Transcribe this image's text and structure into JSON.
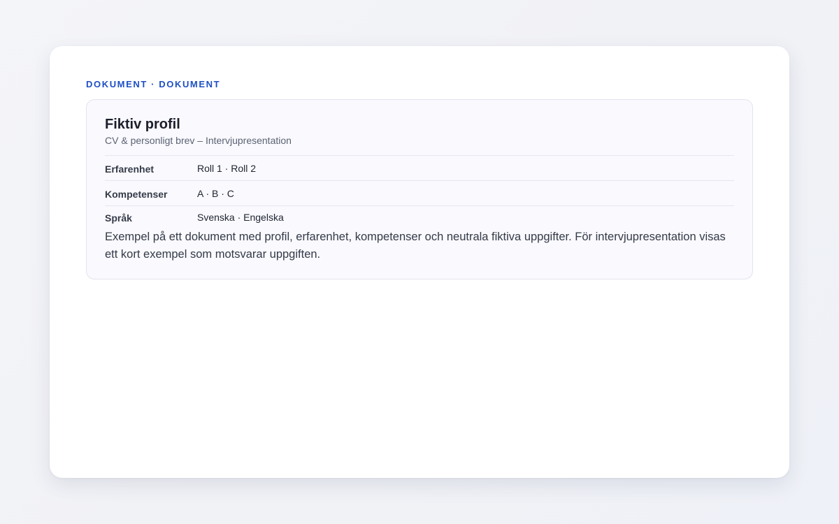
{
  "header": {
    "eyebrow": "DOKUMENT · DOKUMENT"
  },
  "document": {
    "title": "Fiktiv profil",
    "subtitle": "CV & personligt brev – Intervjupresentation",
    "rows": [
      {
        "label": "Erfarenhet",
        "value": "Roll 1 · Roll 2"
      },
      {
        "label": "Kompetenser",
        "value": "A · B · C"
      },
      {
        "label": "Språk",
        "value": "Svenska · Engelska"
      }
    ],
    "body": "Exempel på ett dokument med profil, erfarenhet, kompetenser och neutrala fiktiva uppgifter. För intervjupresentation visas ett kort exempel som motsvarar uppgiften."
  }
}
